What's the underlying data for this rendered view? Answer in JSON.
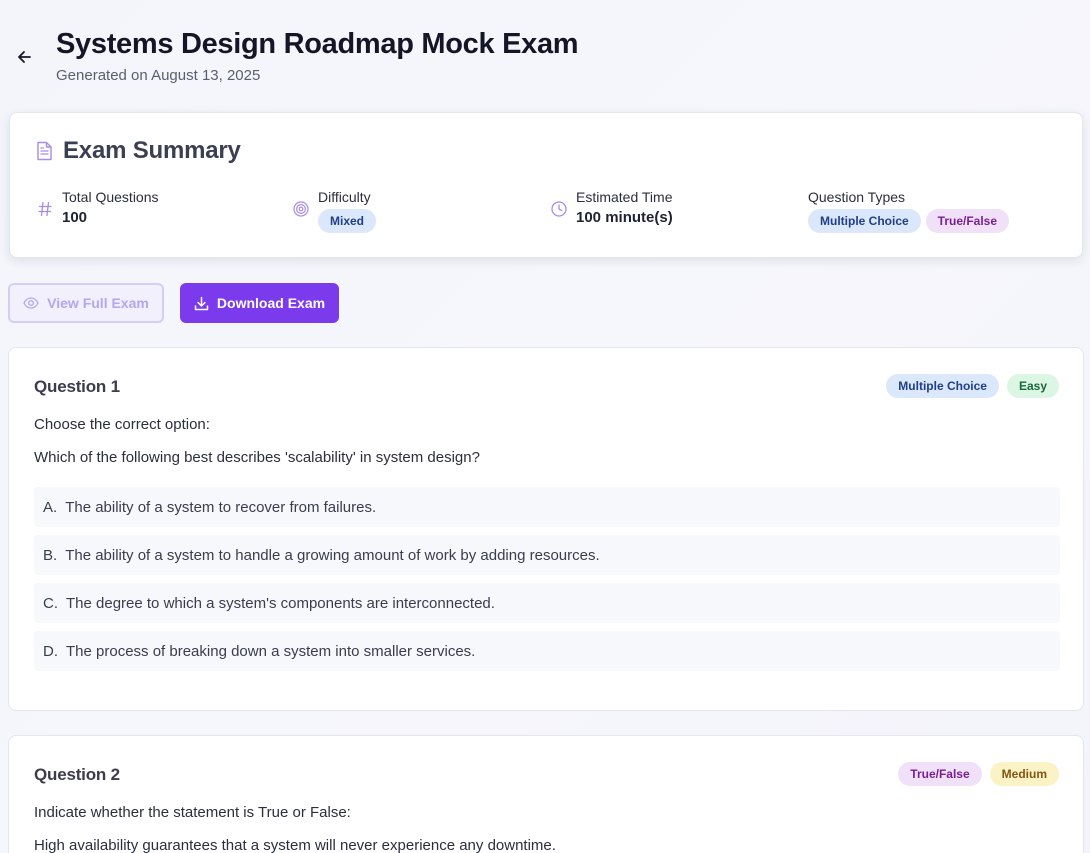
{
  "header": {
    "title": "Systems Design Roadmap Mock Exam",
    "subtitle": "Generated on August 13, 2025",
    "back_icon": "arrow-left-icon"
  },
  "summary": {
    "title": "Exam Summary",
    "icon": "document-icon",
    "total_questions": {
      "label": "Total Questions",
      "value": "100",
      "icon": "hash-icon"
    },
    "difficulty": {
      "label": "Difficulty",
      "value": "Mixed",
      "icon": "target-icon"
    },
    "estimated_time": {
      "label": "Estimated Time",
      "value": "100 minute(s)",
      "icon": "clock-icon"
    },
    "question_types": {
      "label": "Question Types",
      "values": [
        "Multiple Choice",
        "True/False"
      ]
    }
  },
  "actions": {
    "view_label": "View Full Exam",
    "download_label": "Download Exam"
  },
  "questions": [
    {
      "title": "Question 1",
      "type": "Multiple Choice",
      "difficulty": "Easy",
      "instruction": "Choose the correct option:",
      "text": "Which of the following best describes 'scalability' in system design?",
      "options": [
        {
          "letter": "A.",
          "text": "The ability of a system to recover from failures."
        },
        {
          "letter": "B.",
          "text": "The ability of a system to handle a growing amount of work by adding resources."
        },
        {
          "letter": "C.",
          "text": "The degree to which a system's components are interconnected."
        },
        {
          "letter": "D.",
          "text": "The process of breaking down a system into smaller services."
        }
      ]
    },
    {
      "title": "Question 2",
      "type": "True/False",
      "difficulty": "Medium",
      "instruction": "Indicate whether the statement is True or False:",
      "text": "High availability guarantees that a system will never experience any downtime."
    }
  ],
  "colors": {
    "accent": "#7c3aed",
    "pill_blue_bg": "#dbe7fb",
    "pill_purple_bg": "#f0e1f8",
    "pill_green_bg": "#dcf6e4",
    "pill_yellow_bg": "#fbf3c5"
  }
}
